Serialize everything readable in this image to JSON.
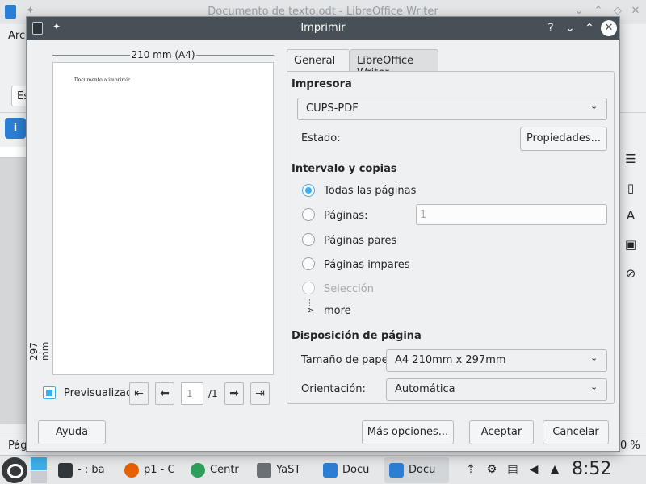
{
  "background": {
    "window_title": "Documento de texto.odt - LibreOffice Writer",
    "menu_first": "Arc",
    "style_box": "Es",
    "info_icon": "i",
    "status_left": "Pág",
    "status_right": "0 %"
  },
  "dialog": {
    "title": "Imprimir",
    "help_glyph": "?",
    "preview": {
      "paper_width": "210 mm (A4)",
      "paper_height": "297 mm",
      "page_text": "Documento a imprimir",
      "preview_label": "Previsualización",
      "page_number": "1",
      "page_total": "/1"
    },
    "tabs": [
      {
        "label": "General"
      },
      {
        "label": "LibreOffice Writer"
      }
    ],
    "printer": {
      "section": "Impresora",
      "selected": "CUPS-PDF",
      "status_label": "Estado:",
      "properties_button": "Propiedades..."
    },
    "range": {
      "section": "Intervalo y copias",
      "all_pages": "Todas las páginas",
      "pages": "Páginas:",
      "pages_value": "1",
      "even_pages": "Páginas pares",
      "odd_pages": "Páginas impares",
      "selection": "Selección",
      "more": "more"
    },
    "layout": {
      "section": "Disposición de página",
      "paper_size_label": "Tamaño de papel",
      "paper_size_value": "A4 210mm x 297mm",
      "orientation_label": "Orientación:",
      "orientation_value": "Automática"
    },
    "buttons": {
      "help": "Ayuda",
      "more_options": "Más opciones...",
      "accept": "Aceptar",
      "cancel": "Cancelar"
    }
  },
  "taskbar": {
    "tasks": [
      {
        "label": "- : ba",
        "icon": "terminal-icon",
        "color": "#31363b"
      },
      {
        "label": "p1 - C",
        "icon": "firefox-icon",
        "color": "#e66000"
      },
      {
        "label": "Centr",
        "icon": "control-center-icon",
        "color": "#2e9f5a"
      },
      {
        "label": "YaST",
        "icon": "printer-icon",
        "color": "#6b7075"
      },
      {
        "label": "Docu",
        "icon": "folder-icon",
        "color": "#2a7fd4"
      },
      {
        "label": "Docu",
        "icon": "writer-icon",
        "color": "#2a7fd4"
      }
    ],
    "clock": "8:52"
  },
  "colors": {
    "accent": "#3daee9",
    "titlebar": "#475057"
  }
}
